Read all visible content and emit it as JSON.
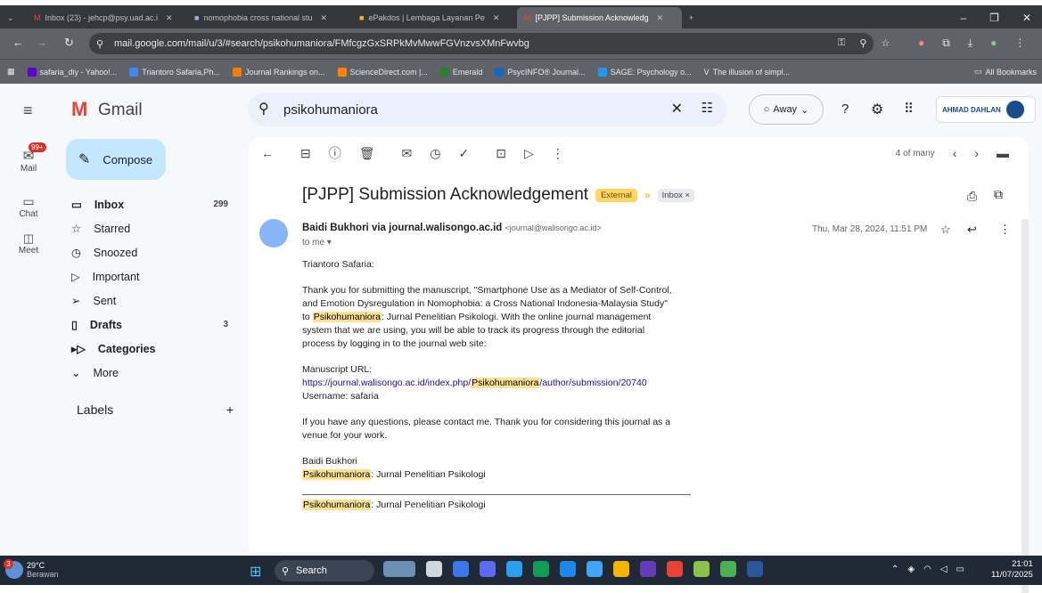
{
  "browser": {
    "tabs": [
      {
        "title": "Inbox (23) - jehcp@psy.uad.ac.i"
      },
      {
        "title": "nomophobia cross national stu"
      },
      {
        "title": "ePakdos | Lembaga Layanan Pe"
      },
      {
        "title": "[PJPP] Submission Acknowledg"
      }
    ],
    "url": "mail.google.com/mail/u/3/#search/psikohumaniora/FMfcgzGxSRPkMvMwwFGVnzvsXMnFwvbg",
    "bookmarks": [
      "safaria_diy - Yahoo!...",
      "Triantoro Safaria,Ph...",
      "Journal Rankings on...",
      "ScienceDirect.com |...",
      "Emerald",
      "PsycINFO® Journal...",
      "SAGE: Psychology o...",
      "The illusion of simpl..."
    ],
    "all_bookmarks": "All Bookmarks"
  },
  "gmail": {
    "brand": "Gmail",
    "search": "psikohumaniora",
    "status": "Away",
    "org": "AHMAD DAHLAN",
    "rail": [
      {
        "label": "Mail",
        "badge": "99+"
      },
      {
        "label": "Chat"
      },
      {
        "label": "Meet"
      }
    ],
    "compose": "Compose",
    "nav": [
      {
        "label": "Inbox",
        "count": "299"
      },
      {
        "label": "Starred",
        "count": ""
      },
      {
        "label": "Snoozed",
        "count": ""
      },
      {
        "label": "Important",
        "count": ""
      },
      {
        "label": "Sent",
        "count": ""
      },
      {
        "label": "Drafts",
        "count": "3"
      },
      {
        "label": "Categories",
        "count": ""
      },
      {
        "label": "More",
        "count": ""
      }
    ],
    "labels": "Labels",
    "labels_add": "+"
  },
  "mail": {
    "pager": "4 of many",
    "subject": "[PJPP] Submission Acknowledgement",
    "badge_external": "External",
    "badge_inbox": "Inbox ×",
    "sender": "Baidi Bukhori via journal.walisongo.ac.id",
    "sender_email": "<journal@walisongo.ac.id>",
    "to": "to me ▾",
    "date": "Thu, Mar 28, 2024, 11:51 PM",
    "greeting": "Triantoro Safaria:",
    "para1_a": "Thank you for submitting the manuscript, \"Smartphone Use as a Mediator of Self-Control, and Emotion Dysregulation in Nomophobia: a Cross National Indonesia-Malaysia Study\" to ",
    "hl": "Psikohumaniora",
    "para1_b": ": Jurnal Penelitian Psikologi. With the online journal management system that we are using, you will be able to track its progress through the editorial process by logging in to the journal web site:",
    "url_label": "Manuscript URL:",
    "url_a": "https://journal.walisongo.ac.id/index.php/",
    "url_b": "/author/submission/20740",
    "username": "Username: safaria",
    "para2": "If you have any questions, please contact me. Thank you for considering this journal as a venue for your work.",
    "sign": "Baidi Bukhori",
    "sign_tail": ": Jurnal Penelitian Psikologi"
  },
  "taskbar": {
    "weather": "29°C",
    "weather_desc": "Berawan",
    "search": "Search",
    "time": "21:01",
    "date": "11/07/2025",
    "badge": "3"
  }
}
